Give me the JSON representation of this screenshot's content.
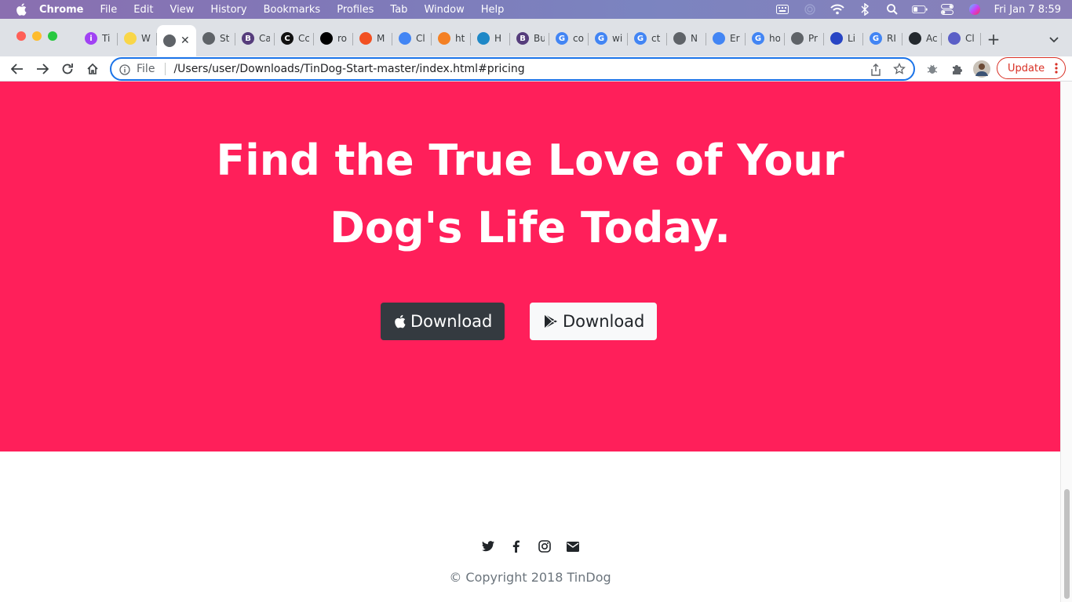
{
  "menubar": {
    "app_name": "Chrome",
    "items": [
      "File",
      "Edit",
      "View",
      "History",
      "Bookmarks",
      "Profiles",
      "Tab",
      "Window",
      "Help"
    ],
    "clock": "Fri Jan 7  8:59",
    "status_icons": [
      "keyboard-icon",
      "airdrop-icon",
      "wifi-icon",
      "bluetooth-icon",
      "spotlight-search-icon",
      "battery-icon",
      "control-center-icon",
      "siri-icon"
    ]
  },
  "tabs": [
    {
      "label": "Ti",
      "icon": "purple-circle-icon",
      "color": "#a142f4",
      "glyph": "i"
    },
    {
      "label": "W",
      "icon": "yellow-badge-icon",
      "color": "#f9d648",
      "glyph": ""
    },
    {
      "label": "",
      "icon": "globe-icon",
      "color": "#5f6368",
      "glyph": "",
      "active": true
    },
    {
      "label": "St",
      "icon": "globe-icon",
      "color": "#5f6368",
      "glyph": ""
    },
    {
      "label": "Ca",
      "icon": "bootstrap-icon",
      "color": "#563d7c",
      "glyph": "B"
    },
    {
      "label": "Cc",
      "icon": "c-black-icon",
      "color": "#111111",
      "glyph": "C"
    },
    {
      "label": "ro",
      "icon": "black-box-icon",
      "color": "#000000",
      "glyph": ""
    },
    {
      "label": "M",
      "icon": "ms-grid-icon",
      "color": "#f25022",
      "glyph": ""
    },
    {
      "label": "Cl",
      "icon": "flag-icon",
      "color": "#4285f4",
      "glyph": ""
    },
    {
      "label": "ht",
      "icon": "stackoverflow-icon",
      "color": "#f48024",
      "glyph": ""
    },
    {
      "label": "H",
      "icon": "code-blue-icon",
      "color": "#1e88c7",
      "glyph": ""
    },
    {
      "label": "Bu",
      "icon": "bootstrap-icon",
      "color": "#563d7c",
      "glyph": "B"
    },
    {
      "label": "co",
      "icon": "google-icon",
      "color": "#4285f4",
      "glyph": "G"
    },
    {
      "label": "wi",
      "icon": "google-icon",
      "color": "#4285f4",
      "glyph": "G"
    },
    {
      "label": "ct",
      "icon": "google-icon",
      "color": "#4285f4",
      "glyph": "G"
    },
    {
      "label": "N",
      "icon": "chrome-icon",
      "color": "#5f6368",
      "glyph": ""
    },
    {
      "label": "Er",
      "icon": "flag-icon",
      "color": "#4285f4",
      "glyph": ""
    },
    {
      "label": "ho",
      "icon": "google-icon",
      "color": "#4285f4",
      "glyph": "G"
    },
    {
      "label": "Pr",
      "icon": "globe-icon",
      "color": "#5f6368",
      "glyph": ""
    },
    {
      "label": "Li",
      "icon": "blue-dot-icon",
      "color": "#2845c4",
      "glyph": ""
    },
    {
      "label": "RI",
      "icon": "google-icon",
      "color": "#4285f4",
      "glyph": "G"
    },
    {
      "label": "Ac",
      "icon": "github-icon",
      "color": "#24292e",
      "glyph": ""
    },
    {
      "label": "Cl",
      "icon": "teams-icon",
      "color": "#5b5fc7",
      "glyph": ""
    }
  ],
  "toolbar": {
    "file_label": "File",
    "url": "/Users/user/Downloads/TinDog-Start-master/index.html#pricing",
    "update_label": "Update"
  },
  "page": {
    "cta_title_line1": "Find the True Love of Your",
    "cta_title_line2": "Dog's Life Today.",
    "download_apple_label": "Download",
    "download_google_label": "Download",
    "copyright": "© Copyright 2018 TinDog",
    "brand_color": "#ff1f5a"
  }
}
